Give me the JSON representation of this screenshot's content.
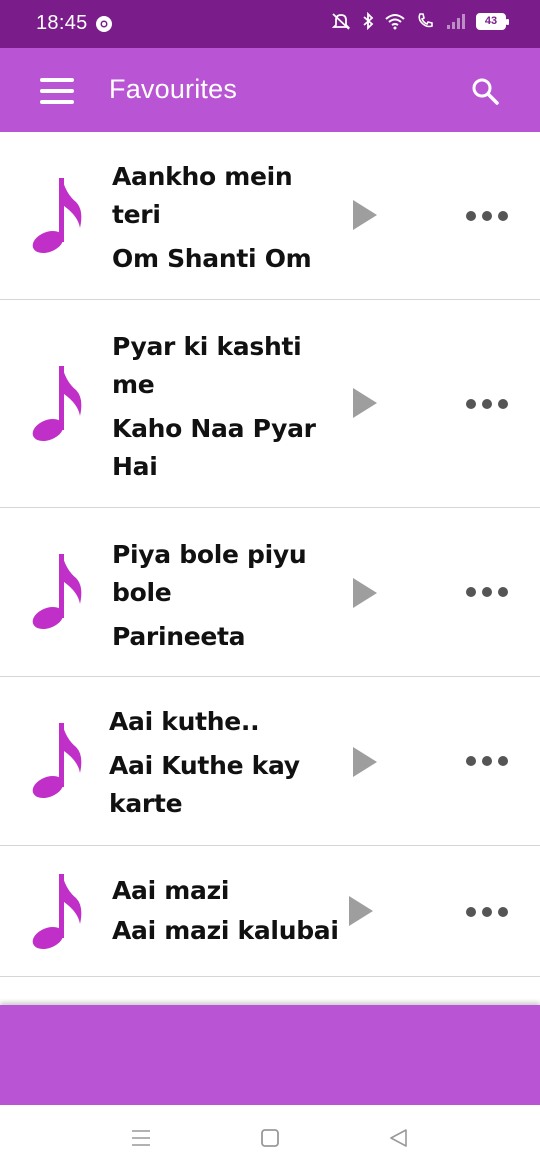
{
  "status_bar": {
    "time": "18:45",
    "battery": "43",
    "icons": [
      "chrome-icon",
      "mute-icon",
      "bluetooth-icon",
      "wifi-icon",
      "volte-call-icon",
      "signal-icon",
      "battery-icon"
    ]
  },
  "app_bar": {
    "title": "Favourites",
    "menu_icon": "hamburger-menu-icon",
    "search_icon": "search-icon"
  },
  "colors": {
    "status_bar": "#7a1d8a",
    "primary": "#b955d4",
    "note_icon": "#c02fc7",
    "play_icon": "#9e9e9e",
    "more_icon": "#555555"
  },
  "songs": [
    {
      "title": "Aankho mein teri",
      "movie": "Om Shanti Om"
    },
    {
      "title": "Pyar ki kashti me",
      "movie": "Kaho Naa Pyar Hai"
    },
    {
      "title": "Piya bole piyu bole",
      "movie": "Parineeta"
    },
    {
      "title": "Aai kuthe..",
      "movie": "Aai Kuthe kay karte"
    },
    {
      "title": "Aai mazi",
      "movie": "Aai mazi kalubai"
    }
  ],
  "nav_bar": {
    "icons": [
      "recent-apps-icon",
      "home-icon",
      "back-icon"
    ]
  }
}
